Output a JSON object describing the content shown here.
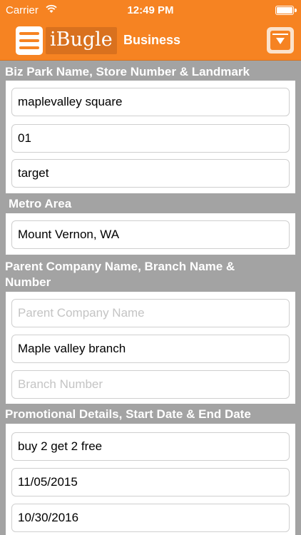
{
  "status_bar": {
    "carrier": "Carrier",
    "time": "12:49 PM"
  },
  "nav": {
    "logo": "iBugle",
    "title": "Business"
  },
  "sections": {
    "biz_park": {
      "header": "Biz Park Name, Store Number & Landmark",
      "fields": [
        {
          "value": "maplevalley square",
          "placeholder": ""
        },
        {
          "value": "01",
          "placeholder": ""
        },
        {
          "value": "target",
          "placeholder": ""
        }
      ]
    },
    "metro": {
      "header": "Metro Area",
      "fields": [
        {
          "value": "Mount Vernon, WA",
          "placeholder": ""
        }
      ]
    },
    "parent": {
      "header_line1": "Parent Company Name, Branch Name &",
      "header_line2": "Number",
      "fields": [
        {
          "value": "",
          "placeholder": "Parent Company Name"
        },
        {
          "value": "Maple valley branch",
          "placeholder": ""
        },
        {
          "value": "",
          "placeholder": "Branch Number"
        }
      ]
    },
    "promo": {
      "header": "Promotional Details, Start Date & End Date",
      "fields": [
        {
          "value": "buy 2 get 2 free",
          "placeholder": ""
        },
        {
          "value": "11/05/2015",
          "placeholder": ""
        },
        {
          "value": "10/30/2016",
          "placeholder": ""
        }
      ]
    }
  }
}
